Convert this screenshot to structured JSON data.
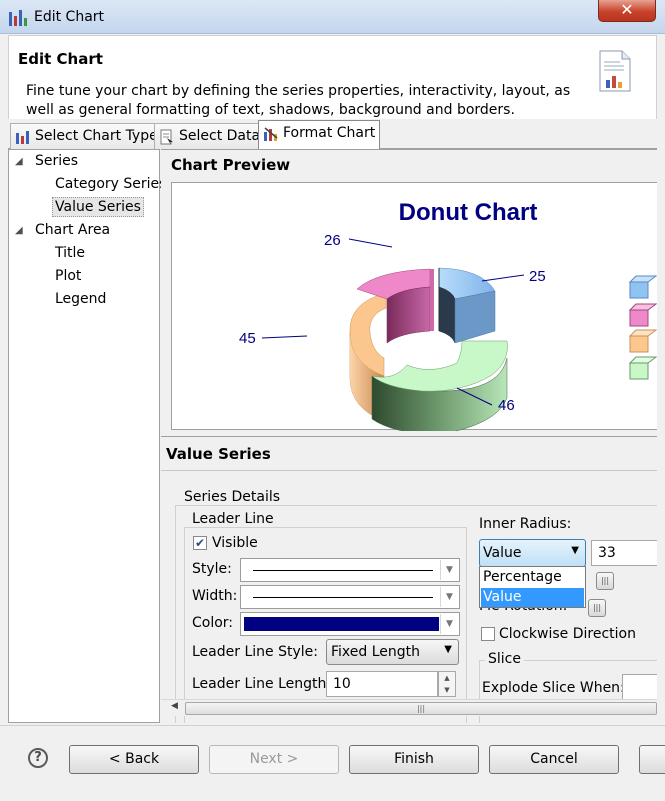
{
  "window": {
    "title": "Edit Chart",
    "close_symbol": "✕"
  },
  "header": {
    "title": "Edit Chart",
    "description": "Fine tune your chart by defining the series properties, interactivity, layout, as well as general formatting of text, shadows, background and borders."
  },
  "tabs": [
    {
      "label": "Select Chart Type"
    },
    {
      "label": "Select Data"
    },
    {
      "label": "Format Chart"
    }
  ],
  "active_tab": "Format Chart",
  "tree": [
    {
      "label": "Series",
      "expanded": true
    },
    {
      "label": "Category Series"
    },
    {
      "label": "Value Series",
      "selected": true
    },
    {
      "label": "Chart Area",
      "expanded": true
    },
    {
      "label": "Title"
    },
    {
      "label": "Plot"
    },
    {
      "label": "Legend"
    }
  ],
  "preview": {
    "label": "Chart Preview",
    "chart_data": {
      "type": "pie",
      "variant": "3d-donut",
      "title": "Donut Chart",
      "values": [
        25,
        46,
        45,
        26
      ],
      "colors": [
        "#8fc3f2",
        "#c8f7c8",
        "#fcc78f",
        "#ee88c8"
      ],
      "legend_position": "right (clipped)",
      "title_color": "#000080",
      "label_color": "#000080"
    }
  },
  "value_series": {
    "section_label": "Value Series",
    "series_details_label": "Series Details",
    "leader_line": {
      "group_label": "Leader Line",
      "visible_label": "Visible",
      "visible_checked": true,
      "style_label": "Style:",
      "width_label": "Width:",
      "color_label": "Color:",
      "color_value": "#000080",
      "leader_line_style_label": "Leader Line Style:",
      "leader_line_style_value": "Fixed Length",
      "leader_line_length_label": "Leader Line Length:",
      "leader_line_length_value": "10"
    },
    "inner_radius": {
      "label": "Inner Radius:",
      "mode_value": "Value",
      "number_value": "33",
      "options": [
        "Percentage",
        "Value"
      ],
      "selected_option": "Value"
    },
    "pie_rotation_label": "Pie Rotation:",
    "clockwise_label": "Clockwise Direction",
    "clockwise_checked": false,
    "slice_label": "Slice",
    "explode_label": "Explode Slice When:"
  },
  "buttons": {
    "help": "?",
    "back": "< Back",
    "next": "Next >",
    "finish": "Finish",
    "cancel": "Cancel"
  }
}
